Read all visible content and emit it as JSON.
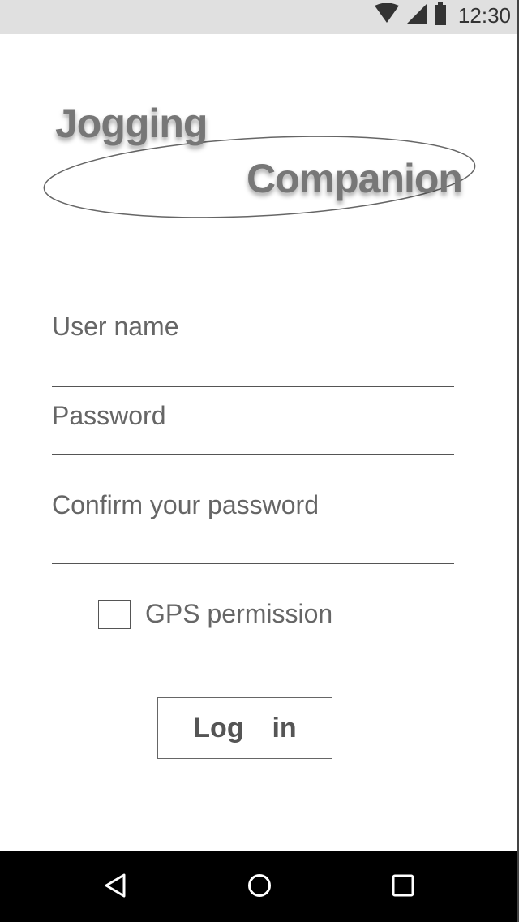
{
  "status_bar": {
    "time": "12:30",
    "icons": [
      "wifi-icon",
      "cell-signal-icon",
      "battery-icon"
    ]
  },
  "logo": {
    "word1": "Jogging",
    "word2": "Companion"
  },
  "form": {
    "username_label": "User name",
    "password_label": "Password",
    "confirm_label": "Confirm your password",
    "gps_label": "GPS permission",
    "gps_checked": false,
    "login_label": "Log  in"
  },
  "nav_bar": {
    "icons": [
      "back-icon",
      "home-icon",
      "recents-icon"
    ]
  },
  "colors": {
    "status_bar_bg": "#e0e0e0",
    "nav_bar_bg": "#000000",
    "label_text": "#666666",
    "logo_text": "#777777",
    "lines": "#555555"
  }
}
